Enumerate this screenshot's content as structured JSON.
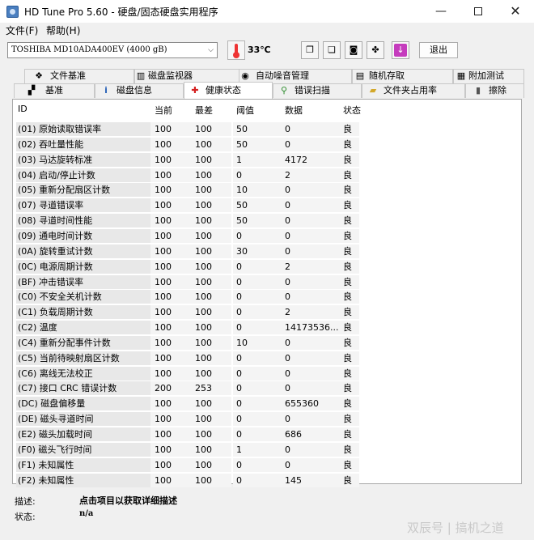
{
  "window": {
    "title": "HD Tune Pro 5.60 - 硬盘/固态硬盘实用程序"
  },
  "menu": {
    "file": "文件(F)",
    "help": "帮助(H)"
  },
  "toolbar": {
    "drive": "TOSHIBA MD10ADA400EV (4000 gB)",
    "temperature": "33℃",
    "exit_label": "退出"
  },
  "tabs_row1": [
    {
      "label": "文件基准",
      "icon": "file-benchmark-icon",
      "glyph": "❖"
    },
    {
      "label": "磁盘监视器",
      "icon": "disk-monitor-icon",
      "glyph": "▥"
    },
    {
      "label": "自动噪音管理",
      "icon": "noise-management-icon",
      "glyph": "◉"
    },
    {
      "label": "随机存取",
      "icon": "random-access-icon",
      "glyph": "▤"
    },
    {
      "label": "附加测试",
      "icon": "extra-tests-icon",
      "glyph": "▦"
    }
  ],
  "tabs_row2": [
    {
      "label": "基准",
      "icon": "benchmark-icon",
      "glyph": "▞"
    },
    {
      "label": "磁盘信息",
      "icon": "disk-info-icon",
      "glyph": "i"
    },
    {
      "label": "健康状态",
      "icon": "health-cross-icon",
      "glyph": "✚"
    },
    {
      "label": "错误扫描",
      "icon": "error-scan-icon",
      "glyph": "⚲"
    },
    {
      "label": "文件夹占用率",
      "icon": "folder-usage-icon",
      "glyph": "▰"
    },
    {
      "label": "擦除",
      "icon": "erase-trash-icon",
      "glyph": "▮"
    }
  ],
  "table": {
    "headers": [
      "ID",
      "当前",
      "最差",
      "阈值",
      "数据",
      "状态"
    ],
    "rows": [
      [
        "(01) 原始读取错误率",
        "100",
        "100",
        "50",
        "0",
        "良"
      ],
      [
        "(02) 吞吐量性能",
        "100",
        "100",
        "50",
        "0",
        "良"
      ],
      [
        "(03) 马达旋转标准",
        "100",
        "100",
        "1",
        "4172",
        "良"
      ],
      [
        "(04) 启动/停止计数",
        "100",
        "100",
        "0",
        "2",
        "良"
      ],
      [
        "(05) 重新分配扇区计数",
        "100",
        "100",
        "10",
        "0",
        "良"
      ],
      [
        "(07) 寻道错误率",
        "100",
        "100",
        "50",
        "0",
        "良"
      ],
      [
        "(08) 寻道时间性能",
        "100",
        "100",
        "50",
        "0",
        "良"
      ],
      [
        "(09) 通电时间计数",
        "100",
        "100",
        "0",
        "0",
        "良"
      ],
      [
        "(0A) 旋转重试计数",
        "100",
        "100",
        "30",
        "0",
        "良"
      ],
      [
        "(0C) 电源周期计数",
        "100",
        "100",
        "0",
        "2",
        "良"
      ],
      [
        "(BF) 冲击错误率",
        "100",
        "100",
        "0",
        "0",
        "良"
      ],
      [
        "(C0) 不安全关机计数",
        "100",
        "100",
        "0",
        "0",
        "良"
      ],
      [
        "(C1) 负载周期计数",
        "100",
        "100",
        "0",
        "2",
        "良"
      ],
      [
        "(C2) 温度",
        "100",
        "100",
        "0",
        "14173536...",
        "良"
      ],
      [
        "(C4) 重新分配事件计数",
        "100",
        "100",
        "10",
        "0",
        "良"
      ],
      [
        "(C5) 当前待映射扇区计数",
        "100",
        "100",
        "0",
        "0",
        "良"
      ],
      [
        "(C6) 离线无法校正",
        "100",
        "100",
        "0",
        "0",
        "良"
      ],
      [
        "(C7) 接口 CRC 错误计数",
        "200",
        "253",
        "0",
        "0",
        "良"
      ],
      [
        "(DC) 磁盘偏移量",
        "100",
        "100",
        "0",
        "655360",
        "良"
      ],
      [
        "(DE) 磁头寻道时间",
        "100",
        "100",
        "0",
        "0",
        "良"
      ],
      [
        "(E2) 磁头加载时间",
        "100",
        "100",
        "0",
        "686",
        "良"
      ],
      [
        "(F0) 磁头飞行时间",
        "100",
        "100",
        "1",
        "0",
        "良"
      ],
      [
        "(F1) 未知属性",
        "100",
        "100",
        "0",
        "0",
        "良"
      ],
      [
        "(F2) 未知属性",
        "100",
        "100",
        "0",
        "145",
        "良"
      ]
    ]
  },
  "footer": {
    "desc_label": "描述:",
    "desc_value": "点击项目以获取详细描述",
    "status_label": "状态:",
    "status_value": "n/a"
  },
  "watermark": "双辰号 | 搞机之道"
}
